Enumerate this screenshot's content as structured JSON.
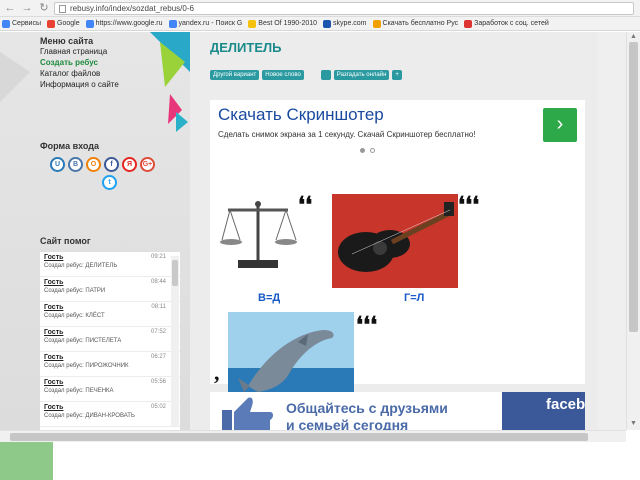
{
  "browser": {
    "url": "rebusy.info/index/sozdat_rebus/0-6",
    "bookmarks": [
      {
        "label": "Сервисы",
        "color": "#4285f4"
      },
      {
        "label": "Google",
        "color": "#e94235"
      },
      {
        "label": "https://www.google.ru",
        "color": "#4285f4"
      },
      {
        "label": "yandex.ru - Поиск G",
        "color": "#4285f4"
      },
      {
        "label": "Best Of 1990-2010",
        "color": "#f4c20d"
      },
      {
        "label": "skype.com",
        "color": "#1a56b0"
      },
      {
        "label": "Скачать бесплатно Рус",
        "color": "#f0a000"
      },
      {
        "label": "Заработок с соц. сетей",
        "color": "#d33"
      }
    ]
  },
  "sidebar": {
    "menu_title": "Меню сайта",
    "menu_items": [
      "Главная страница",
      "Создать ребус",
      "Каталог файлов",
      "Информация о сайте"
    ],
    "login_title": "Форма входа",
    "social": [
      {
        "label": "U",
        "color": "#2a7ab8"
      },
      {
        "label": "В",
        "color": "#4a76a8"
      },
      {
        "label": "О",
        "color": "#ee8208"
      },
      {
        "label": "f",
        "color": "#3b5998"
      },
      {
        "label": "Я",
        "color": "#e52620"
      },
      {
        "label": "G+",
        "color": "#dd4b39"
      },
      {
        "label": "t",
        "color": "#1da1f2"
      }
    ],
    "chat_title": "Сайт помог",
    "chat": [
      {
        "user": "Гость",
        "time": "09:21",
        "msg": "Создал ребус: ДЕЛИТЕЛЬ"
      },
      {
        "user": "Гость",
        "time": "08:44",
        "msg": "Создал ребус: ПАТРИ"
      },
      {
        "user": "Гость",
        "time": "08:11",
        "msg": "Создал ребус: КЛЁСТ"
      },
      {
        "user": "Гость",
        "time": "07:52",
        "msg": "Создал ребус: ПИСТЕЛЕТА"
      },
      {
        "user": "Гость",
        "time": "06:27",
        "msg": "Создал ребус: ПИРОЖОЧНИК"
      },
      {
        "user": "Гость",
        "time": "05:56",
        "msg": "Создал ребус: ПЕЧЕНКА"
      },
      {
        "user": "Гость",
        "time": "05:02",
        "msg": "Создал ребус: ДИВАН-КРОВАТЬ"
      }
    ]
  },
  "main": {
    "heading": "ДЕЛИТЕЛЬ",
    "pills": [
      "Другой вариант",
      "Новое слово",
      "",
      "Разгадать онлайн",
      "+"
    ],
    "ad": {
      "title": "Скачать Скриншотер",
      "subtitle": "Сделать снимок экрана за 1 секунду. Скачай Скриншотер бесплатно!",
      "go": "›"
    },
    "puzzle": {
      "eq_left": "В=Д",
      "eq_right": "Г=Л",
      "quote2": "❛❛",
      "quote3": "❛❛❛",
      "comma": ","
    },
    "banner": {
      "line1": "Общайтесь с друзьями",
      "line2": "и семьей сегодня",
      "brand": "faceb"
    }
  }
}
